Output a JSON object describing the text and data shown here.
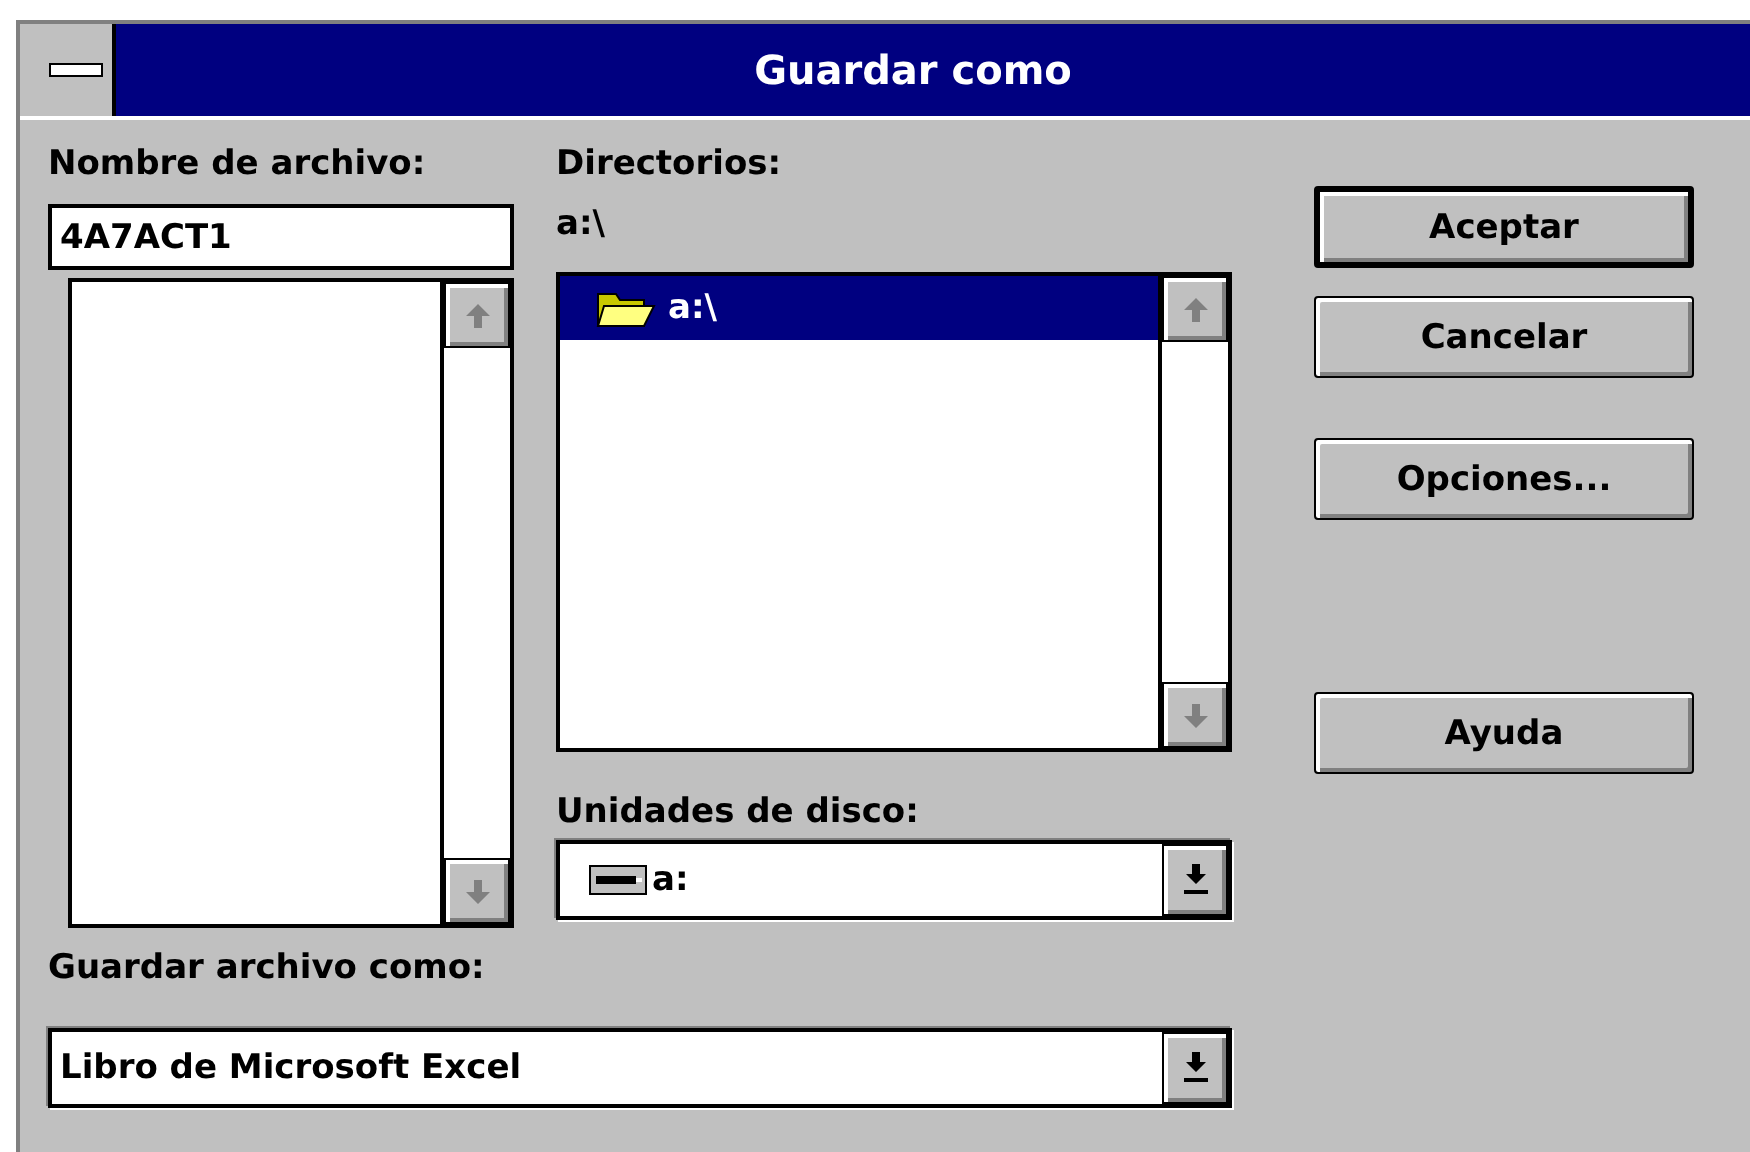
{
  "window": {
    "title": "Guardar como"
  },
  "file_name": {
    "label": "Nombre de archivo:",
    "value": "4A7ACT1"
  },
  "directories": {
    "label": "Directorios:",
    "current": "a:\\",
    "items": [
      {
        "name": "a:\\",
        "selected": true
      }
    ]
  },
  "drives": {
    "label": "Unidades de disco:",
    "value": "a:"
  },
  "file_type": {
    "label": "Guardar archivo como:",
    "value": "Libro de Microsoft Excel"
  },
  "buttons": [
    {
      "label": "Aceptar",
      "default": true
    },
    {
      "label": "Cancelar",
      "default": false
    },
    {
      "label": "Opciones...",
      "default": false
    },
    {
      "label": "Ayuda",
      "default": false
    }
  ]
}
